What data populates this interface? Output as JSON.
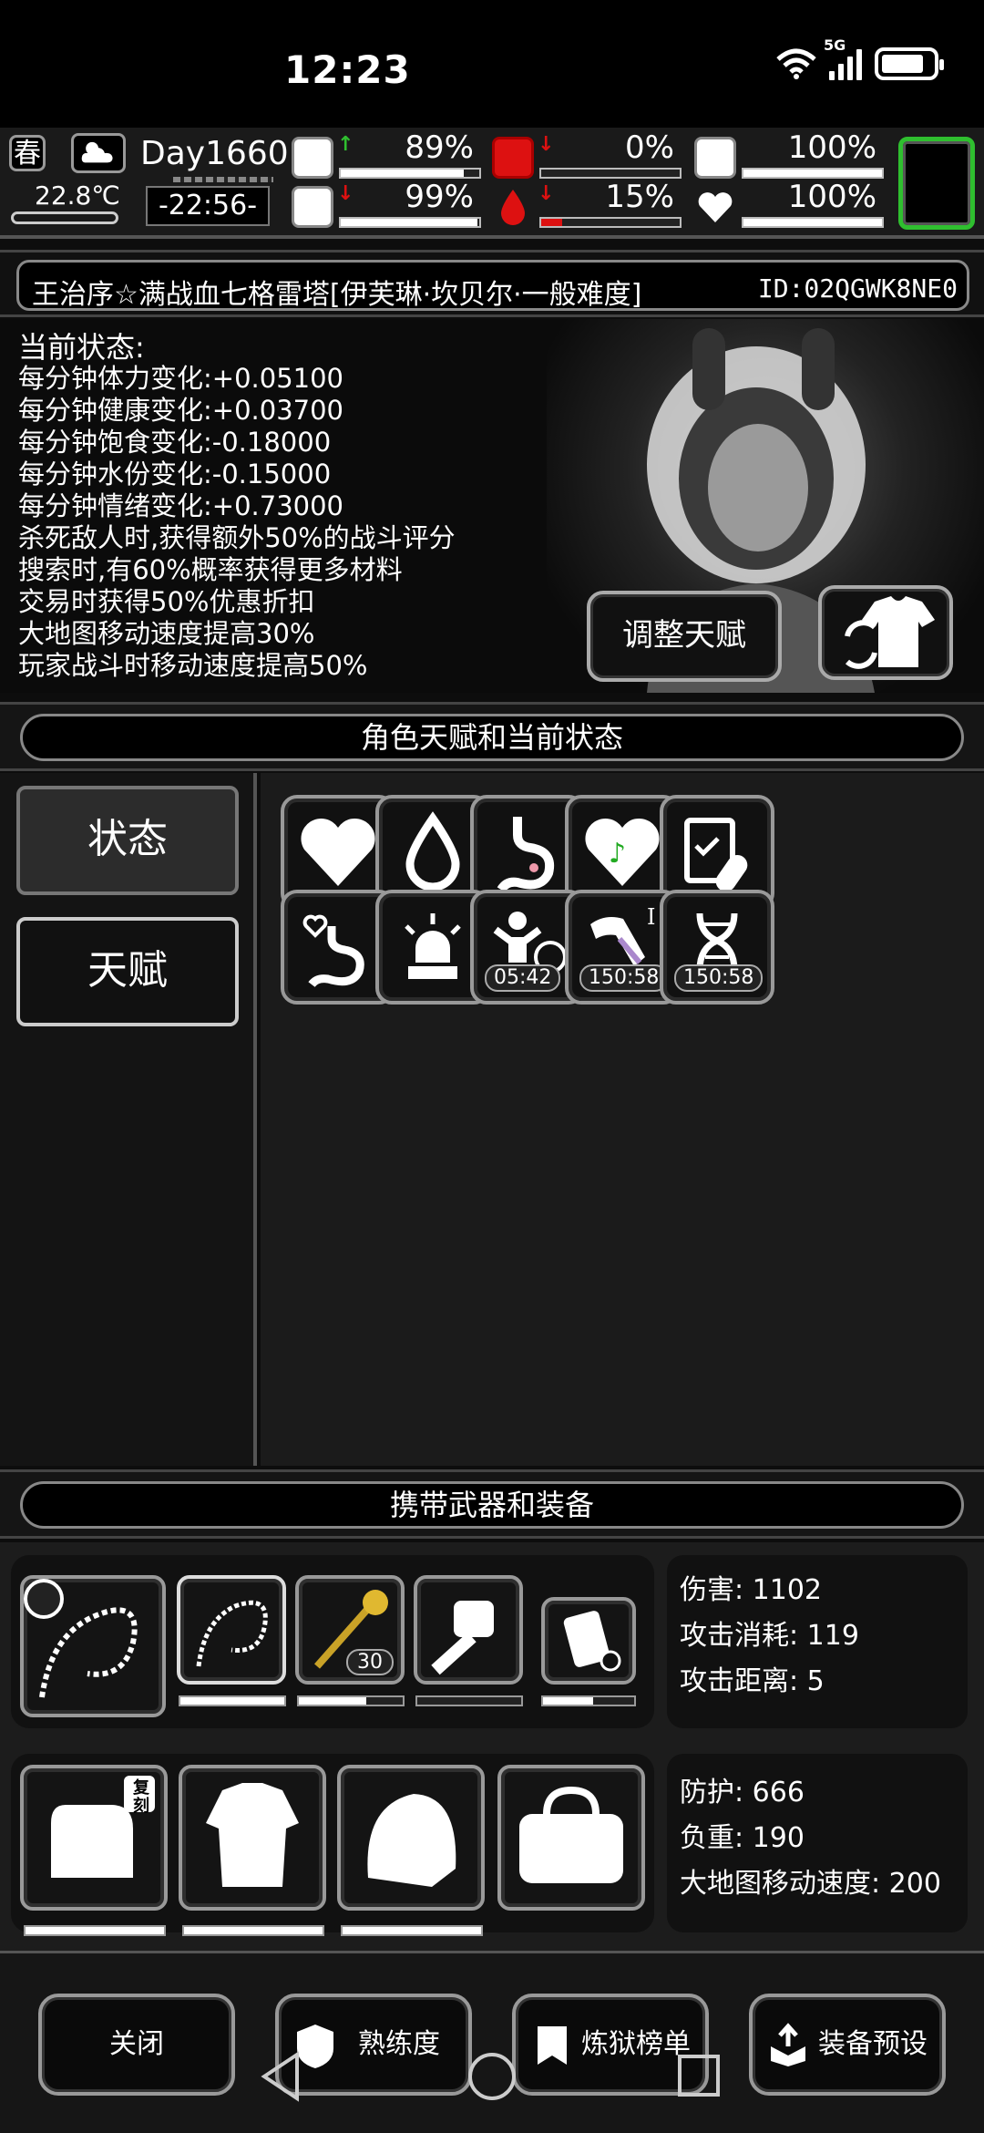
{
  "system": {
    "time": "12:23",
    "network": "5G"
  },
  "top": {
    "season": "春",
    "temperature": "22.8℃",
    "day": "Day1660",
    "clock": "-22:56-",
    "stats": [
      {
        "name": "health",
        "icon": "medkit-icon",
        "arrow": "up",
        "value": "89%",
        "fill": 0.89
      },
      {
        "name": "hunger",
        "icon": "stomach-icon",
        "arrow": "down",
        "value": "0%",
        "fill": 0.0
      },
      {
        "name": "mood",
        "icon": "face-icon",
        "arrow": "",
        "value": "100%",
        "fill": 1.0
      },
      {
        "name": "stamina",
        "icon": "boot-icon",
        "arrow": "down",
        "value": "99%",
        "fill": 0.99
      },
      {
        "name": "water",
        "icon": "blood-drop-icon",
        "arrow": "down",
        "value": "15%",
        "fill": 0.15
      },
      {
        "name": "heart",
        "icon": "heart-icon",
        "arrow": "",
        "value": "100%",
        "fill": 1.0
      }
    ]
  },
  "header": {
    "title": "王治序☆满战血七格雷塔[伊芙琳·坎贝尔·一般难度]",
    "id": "ID:02QGWK8NE0"
  },
  "status": {
    "heading": "当前状态:",
    "lines": [
      "每分钟体力变化:+0.05100",
      "每分钟健康变化:+0.03700",
      "每分钟饱食变化:-0.18000",
      "每分钟水份变化:-0.15000",
      "每分钟情绪变化:+0.73000",
      "杀死敌人时,获得额外50%的战斗评分",
      "搜索时,有60%概率获得更多材料",
      "交易时获得50%优惠折扣",
      "大地图移动速度提高30%",
      "玩家战斗时移动速度提高50%"
    ],
    "adjust_button": "调整天赋"
  },
  "talent_section": {
    "title": "角色天赋和当前状态"
  },
  "tabs": {
    "status": "状态",
    "talent": "天赋"
  },
  "effects": [
    {
      "icon": "heart-icon",
      "timer": ""
    },
    {
      "icon": "water-drop-icon",
      "timer": ""
    },
    {
      "icon": "stomach-icon",
      "timer": ""
    },
    {
      "icon": "music-heart-icon",
      "timer": ""
    },
    {
      "icon": "medicine-clipboard-icon",
      "timer": ""
    },
    {
      "icon": "stomach-heart-icon",
      "timer": ""
    },
    {
      "icon": "alarm-light-icon",
      "timer": ""
    },
    {
      "icon": "sleeping-person-icon",
      "timer": "05:42"
    },
    {
      "icon": "injured-arm-icon",
      "timer": "150:58"
    },
    {
      "icon": "dna-icon",
      "timer": "150:58"
    }
  ],
  "equip_section": {
    "title": "携带武器和装备"
  },
  "weapons": {
    "damage": "伤害: 1102",
    "attack_cost": "攻击消耗: 119",
    "attack_range": "攻击距离: 5",
    "ammo_count": "30",
    "badge": "复刻"
  },
  "armor": {
    "defense": "防护: 666",
    "weight": "负重: 190",
    "map_speed": "大地图移动速度: 200"
  },
  "buttons": {
    "close": "关闭",
    "proficiency": "熟练度",
    "ranking": "炼狱榜单",
    "preset": "装备预设"
  }
}
